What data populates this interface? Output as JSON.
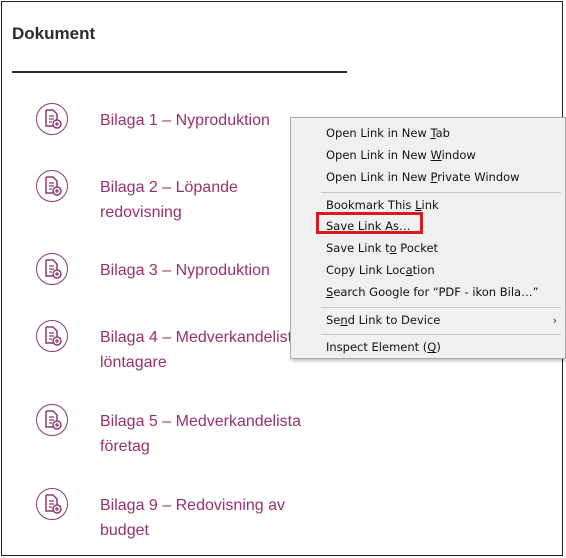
{
  "section": {
    "title": "Dokument"
  },
  "documents": [
    {
      "label": "Bilaga 1 – Nyproduktion"
    },
    {
      "label": "Bilaga 2 – Löpande redovisning"
    },
    {
      "label": "Bilaga 3 – Nyproduktion"
    },
    {
      "label": "Bilaga 4 – Medverkandelista löntagare"
    },
    {
      "label": "Bilaga 5 – Medverkandelista företag"
    },
    {
      "label": "Bilaga 9 – Redovisning av budget"
    }
  ],
  "context_menu": {
    "items": [
      {
        "pre": "Open Link in New ",
        "key": "T",
        "post": "ab"
      },
      {
        "pre": "Open Link in New ",
        "key": "W",
        "post": "indow"
      },
      {
        "pre": "Open Link in New ",
        "key": "P",
        "post": "rivate Window"
      },
      {
        "pre": "Bookmark This ",
        "key": "L",
        "post": "ink"
      },
      {
        "pre": "Save Lin",
        "key": "k",
        "post": " As…"
      },
      {
        "pre": "Save Link t",
        "key": "o",
        "post": " Pocket"
      },
      {
        "pre": "Copy Link Loc",
        "key": "a",
        "post": "tion"
      },
      {
        "pre": "",
        "key": "S",
        "post": "earch Google for “PDF - ikon Bila…”"
      },
      {
        "pre": "Se",
        "key": "n",
        "post": "d Link to Device"
      },
      {
        "pre": "Inspect Element (",
        "key": "Q",
        "post": ")"
      }
    ],
    "submenu_arrow": "›",
    "highlighted_item": "Save Link As…",
    "highlight_color": "#d71920"
  },
  "colors": {
    "link": "#97306f",
    "icon_stroke": "#8c3a6e",
    "menu_bg": "#f0f0f0"
  },
  "icons": {
    "document": "pdf-download-icon"
  }
}
